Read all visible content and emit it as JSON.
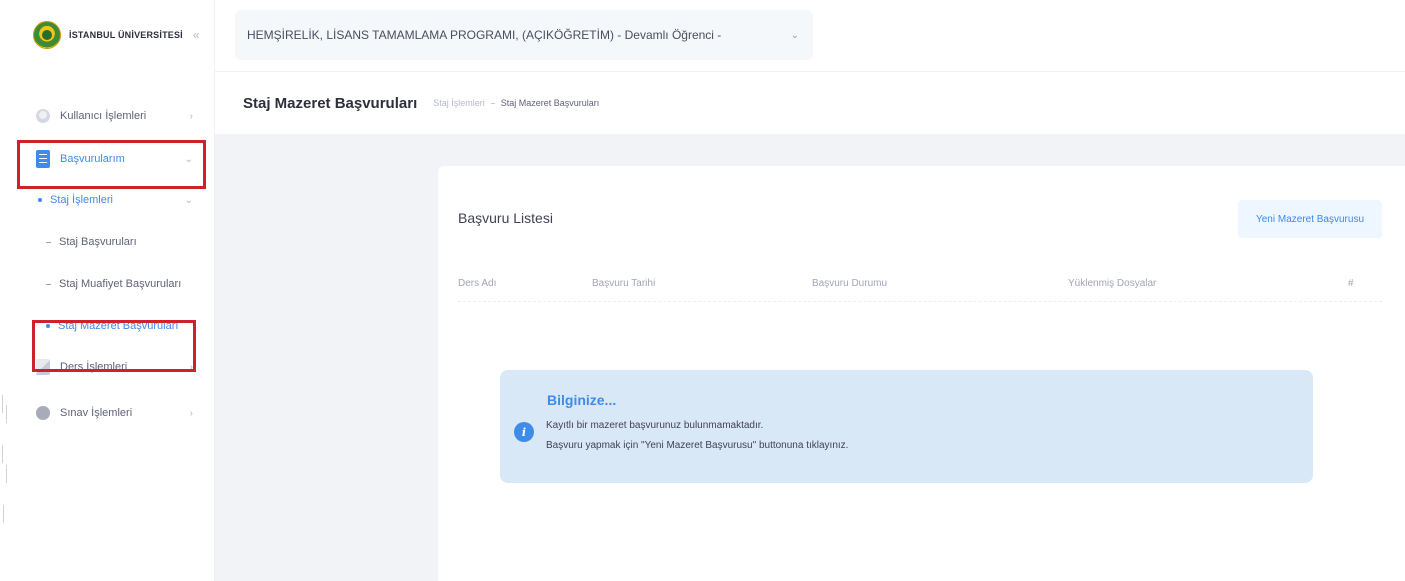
{
  "sidebar": {
    "logo_text": "İSTANBUL ÜNİVERSİTESİ",
    "collapse_glyph": "«",
    "items": [
      {
        "label": "Kullanıcı İşlemleri",
        "icon": "user-icon"
      },
      {
        "label": "Başvurularım",
        "icon": "scroll-icon"
      },
      {
        "label": "Staj İşlemleri"
      },
      {
        "label": "Staj Başvuruları"
      },
      {
        "label": "Staj Muafiyet Başvuruları"
      },
      {
        "label": "Staj Mazeret Başvuruları"
      },
      {
        "label": "Ders İşlemleri",
        "icon": "book-icon"
      },
      {
        "label": "Sınav İşlemleri",
        "icon": "exam-icon"
      }
    ]
  },
  "header": {
    "program_select_value": "HEMŞİRELİK, LİSANS TAMAMLAMA PROGRAMI, (AÇIKÖĞRETİM) - Devamlı Öğrenci -"
  },
  "page": {
    "title": "Staj Mazeret Başvuruları",
    "breadcrumb": [
      "Staj İşlemleri",
      "Staj Mazeret Başvuruları"
    ]
  },
  "card": {
    "title": "Başvuru Listesi",
    "new_button_label": "Yeni Mazeret Başvurusu",
    "columns": [
      "Ders Adı",
      "Başvuru Tarihi",
      "Başvuru Durumu",
      "Yüklenmiş Dosyalar",
      "#"
    ]
  },
  "alert": {
    "icon": "info-icon",
    "title": "Bilginize...",
    "line1": "Kayıtlı bir mazeret başvurunuz bulunmamaktadır.",
    "line2": "Başvuru yapmak için \"Yeni Mazeret Başvurusu\" buttonuna tıklayınız."
  },
  "colors": {
    "accent": "#3e8be8",
    "highlight": "#d0202a",
    "alert_bg": "#d9e8f7"
  }
}
